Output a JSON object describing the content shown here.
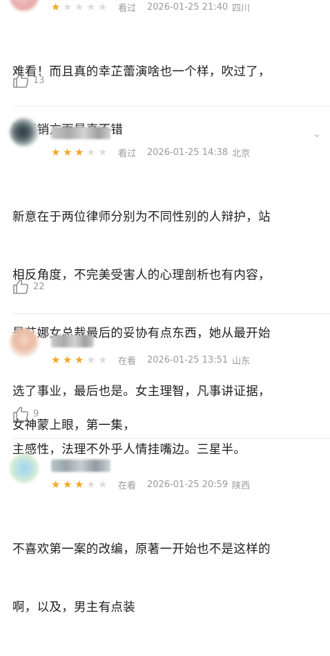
{
  "reviews": [
    {
      "stars": 1,
      "status": "看过",
      "date": "2026-01-25 21:40",
      "location": "四川",
      "text_lines": [
        "难看！而且真的幸芷蕾演啥也一个样，吹过了，",
        "队营销方面是真不错"
      ],
      "likes": "13"
    },
    {
      "stars": 3,
      "status": "看过",
      "date": "2026-01-25 14:38",
      "location": "北京",
      "text_lines": [
        "新意在于两位律师分别为不同性别的人辩护，站",
        "相反角度，不完美受害人的心理剖析也有内容，",
        "是艾娜女总裁最后的妥协有点东西，她从最开始",
        "选了事业，最后也是。女主理智，凡事讲证据，",
        "主感性，法理不外乎人情挂嘴边。三星半。"
      ],
      "likes": "22"
    },
    {
      "stars": 3,
      "status": "在看",
      "date": "2026-01-25 13:51",
      "location": "山东",
      "text_lines": [
        "女神蒙上眼，第一集，"
      ],
      "likes": "9"
    },
    {
      "stars": 3,
      "status": "在看",
      "date": "2026-01-25 20:59",
      "location": "陕西",
      "text_lines": [
        "不喜欢第一案的改编，原著一开始也不是这样的",
        "啊，以及，男主有点装"
      ],
      "likes": ""
    }
  ],
  "colors": {
    "star_on": "#f5a623",
    "star_off": "#dcdcdc",
    "meta": "#9a9a9a"
  },
  "icons": {
    "like": "thumbs-up-icon",
    "more": "chevron-down-icon"
  }
}
